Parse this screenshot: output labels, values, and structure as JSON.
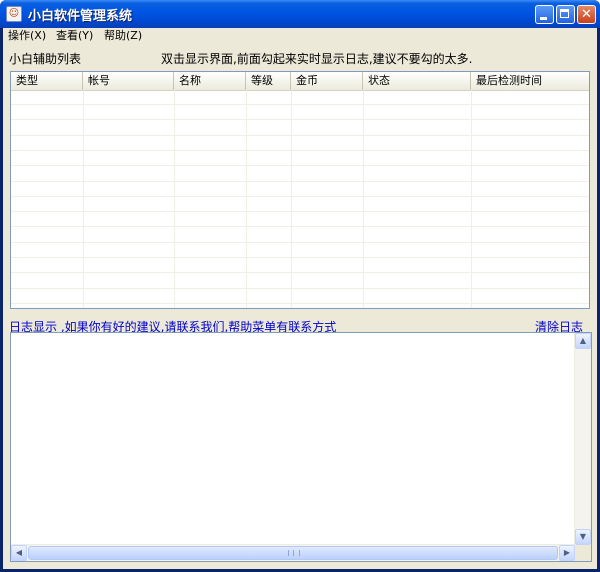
{
  "window": {
    "title": "小白软件管理系统",
    "icon": "app-icon",
    "title_color": "#0054e3"
  },
  "menubar": {
    "items": [
      {
        "label": "操作(X)"
      },
      {
        "label": "查看(Y)"
      },
      {
        "label": "帮助(Z)"
      }
    ]
  },
  "assist_list": {
    "label": "小白辅助列表",
    "hint": "双击显示界面,前面勾起来实时显示日志,建议不要勾的太多.",
    "columns": [
      "类型",
      "帐号",
      "名称",
      "等级",
      "金币",
      "状态",
      "最后检测时间"
    ],
    "rows": []
  },
  "log": {
    "label": "日志显示  ,如果你有好的建议,请联系我们,帮助菜单有联系方式",
    "clear_label": "清除日志",
    "link_color": "#0000cc",
    "content": ""
  }
}
